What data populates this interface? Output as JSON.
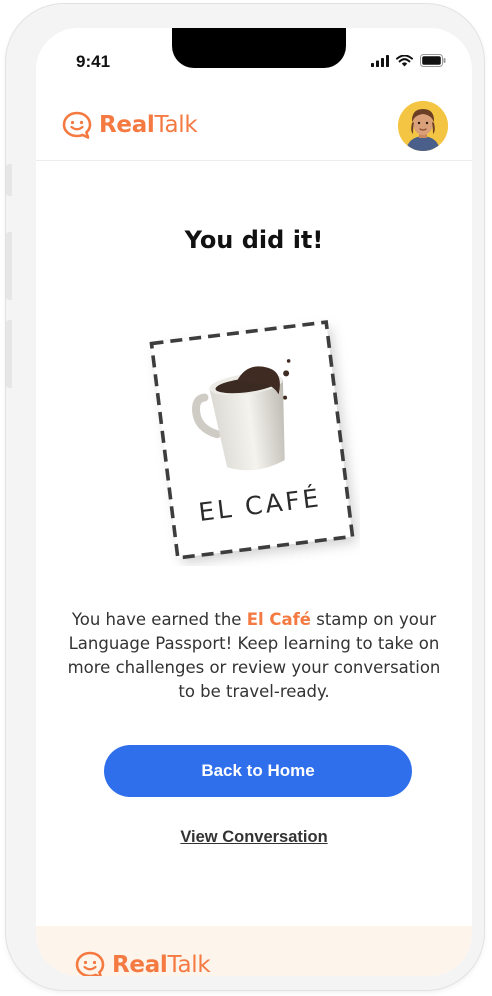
{
  "status_bar": {
    "time": "9:41",
    "icons": [
      "signal-icon",
      "wifi-icon",
      "battery-icon"
    ]
  },
  "header": {
    "brand_part1": "Real",
    "brand_part2": "Talk",
    "logo_icon": "smile-chat-icon",
    "avatar": "user-avatar"
  },
  "main": {
    "title": "You did it!",
    "stamp_label": "EL CAFÉ",
    "message_before": "You have earned the ",
    "message_highlight": "El Café",
    "message_after": " stamp on your Language Passport! Keep learning to take on more challenges or review your conversation to be travel-ready.",
    "primary_button": "Back to Home",
    "secondary_link": "View Conversation"
  },
  "footer": {
    "brand_part1": "Real",
    "brand_part2": "Talk"
  },
  "colors": {
    "brand": "#f47a42",
    "primary": "#2f6fec",
    "footer_bg": "#fdf4ec"
  }
}
